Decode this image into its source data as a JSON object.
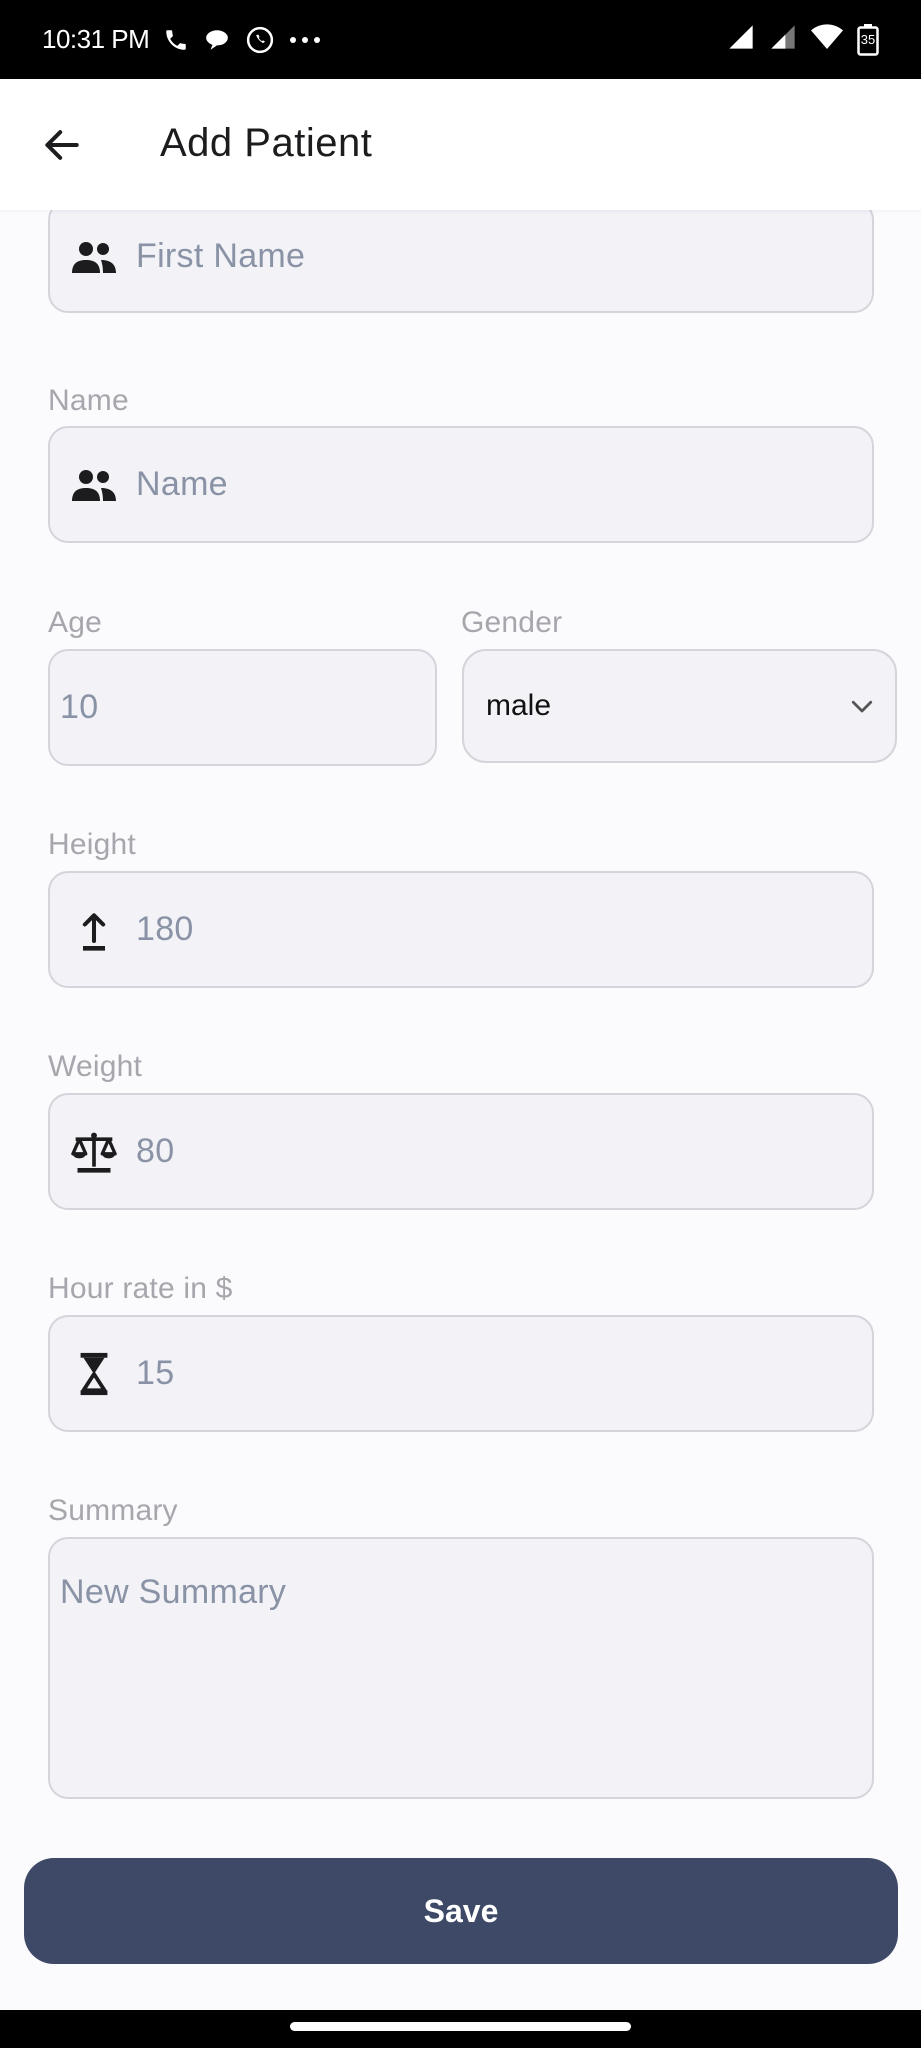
{
  "status_bar": {
    "time": "10:31 PM",
    "battery": "35",
    "left_icons": [
      "phone-icon",
      "chat-bubble-icon",
      "whatsapp-icon",
      "more-dots-icon"
    ],
    "right_icons": [
      "signal-icon",
      "signal-weak-icon",
      "wifi-icon",
      "battery-icon"
    ]
  },
  "app_bar": {
    "title": "Add Patient",
    "back_icon": "arrow-left-icon"
  },
  "form": {
    "first_name": {
      "placeholder": "First Name",
      "icon": "people-icon"
    },
    "name": {
      "label": "Name",
      "placeholder": "Name",
      "icon": "people-icon"
    },
    "age": {
      "label": "Age",
      "value": "10"
    },
    "gender": {
      "label": "Gender",
      "value": "male",
      "icon": "chevron-down-icon"
    },
    "height": {
      "label": "Height",
      "value": "180",
      "icon": "arrow-up-icon"
    },
    "weight": {
      "label": "Weight",
      "value": "80",
      "icon": "scale-icon"
    },
    "hour_rate": {
      "label": "Hour rate in $",
      "value": "15",
      "icon": "hourglass-icon"
    },
    "summary": {
      "label": "Summary",
      "placeholder": "New Summary"
    }
  },
  "actions": {
    "save_label": "Save"
  },
  "colors": {
    "primary": "#3d4966",
    "field_bg": "#f2f2f7",
    "field_border": "#d4d4db",
    "label": "#a6a6ad",
    "placeholder": "#8a93a6"
  }
}
